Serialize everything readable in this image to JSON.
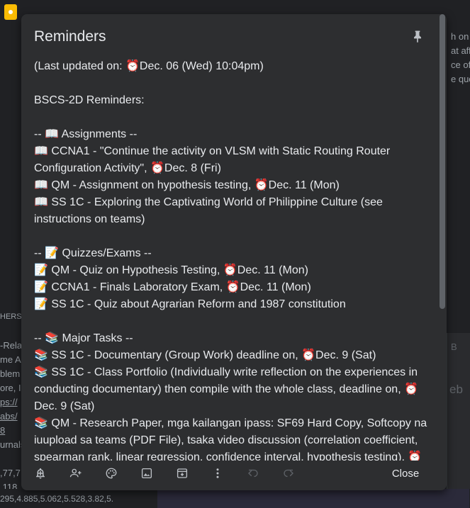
{
  "background": {
    "right_texts": [
      "h on",
      "at aff",
      "ce of",
      "e quo"
    ],
    "left_texts": [
      "HERS",
      "-Rela",
      "me A",
      "blem",
      "ore, I",
      "ps://",
      "abs/",
      "8",
      "urnals"
    ],
    "bottom_texts": [
      ",77,7",
      ",118,",
      "295,4.885,5.062,5.528,3.82,5."
    ],
    "right_card_letter": "eb",
    "right_card_letter2": "B"
  },
  "dialog": {
    "title": "Reminders",
    "lines": [
      "(Last updated on: ⏰Dec. 06 (Wed) 10:04pm)",
      "",
      "BSCS-2D Reminders:",
      "",
      "-- 📖 Assignments --",
      "📖 CCNA1 - \"Continue the activity on VLSM with Static Routing Router",
      "Configuration Activity\", ⏰Dec. 8 (Fri)",
      "📖 QM - Assignment on hypothesis testing, ⏰Dec. 11 (Mon)",
      "📖 SS 1C - Exploring the Captivating World of Philippine Culture (see",
      "instructions on teams)",
      "",
      "-- 📝 Quizzes/Exams --",
      "📝 QM - Quiz on Hypothesis Testing, ⏰Dec. 11 (Mon)",
      "📝 CCNA1 - Finals Laboratory Exam, ⏰Dec. 11 (Mon)",
      "📝 SS 1C - Quiz about Agrarian Reform and 1987 constitution",
      "",
      "-- 📚 Major Tasks --",
      "📚 SS 1C - Documentary (Group Work) deadline on, ⏰Dec. 9 (Sat)",
      "📚 SS 1C - Class Portfolio (Individually write reflection on the experiences in",
      "conducting documentary) then compile with the whole class, deadline on, ⏰",
      "Dec. 9 (Sat)",
      "📚 QM - Research Paper, mga kailangan ipass: SF69 Hard Copy, Softcopy na",
      "iuupload sa teams (PDF File), tsaka video discussion (correlation coefficient,",
      "spearman rank, linear regression, confidence interval, hypothesis testing), ⏰"
    ],
    "close_label": "Close"
  }
}
